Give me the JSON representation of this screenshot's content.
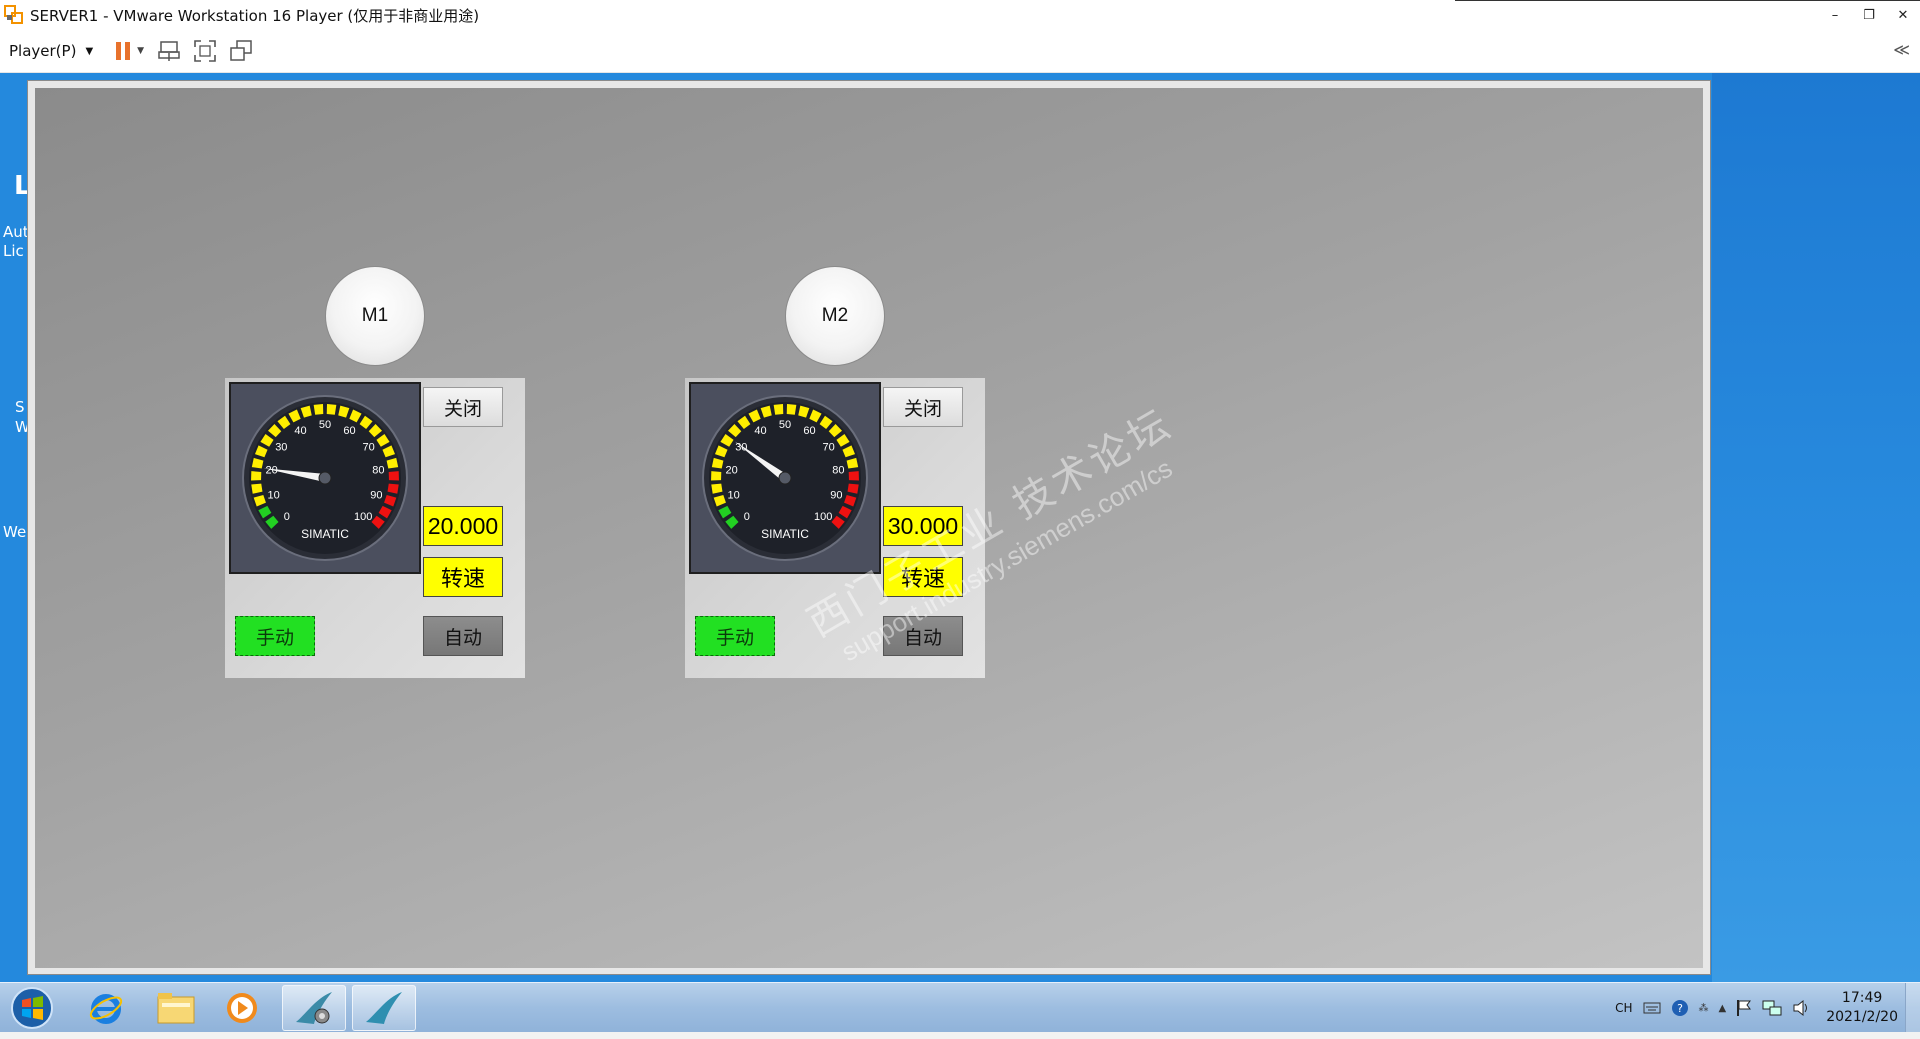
{
  "window": {
    "title": "SERVER1 - VMware Workstation 16 Player (仅用于非商业用途)",
    "controls": {
      "minimize": "–",
      "restore": "❐",
      "close": "✕"
    }
  },
  "toolbar": {
    "player_menu": "Player(P)",
    "collapse": "≪"
  },
  "desktop_left_fragments": [
    "L",
    "Aut",
    "Lic",
    "S",
    "W",
    "We"
  ],
  "hmi": {
    "motors": [
      {
        "name": "M1",
        "close_label": "关闭",
        "speed_value": "20.000",
        "speed_label": "转速",
        "manual_label": "手动",
        "auto_label": "自动",
        "gauge": {
          "value": 20,
          "min": 0,
          "max": 100,
          "brand": "SIMATIC",
          "ticks": [
            "0",
            "10",
            "20",
            "30",
            "40",
            "50",
            "60",
            "70",
            "80",
            "90",
            "100"
          ]
        }
      },
      {
        "name": "M2",
        "close_label": "关闭",
        "speed_value": "30.000",
        "speed_label": "转速",
        "manual_label": "手动",
        "auto_label": "自动",
        "gauge": {
          "value": 30,
          "min": 0,
          "max": 100,
          "brand": "SIMATIC",
          "ticks": [
            "0",
            "10",
            "20",
            "30",
            "40",
            "50",
            "60",
            "70",
            "80",
            "90",
            "100"
          ]
        }
      }
    ],
    "colors": {
      "manual_active": "#22e022",
      "value_bg": "#ffff00",
      "gauge_face": "#1e2129"
    }
  },
  "watermark": {
    "line1": "西门子工业 技术论坛",
    "line2": "support.industry.siemens.com/cs"
  },
  "taskbar": {
    "items": [
      "start-orb",
      "internet-explorer-icon",
      "file-explorer-icon",
      "media-player-icon",
      "tia-portal-icon",
      "wincc-runtime-icon"
    ],
    "tray": {
      "language": "CH",
      "time": "17:49",
      "date": "2021/2/20"
    }
  }
}
